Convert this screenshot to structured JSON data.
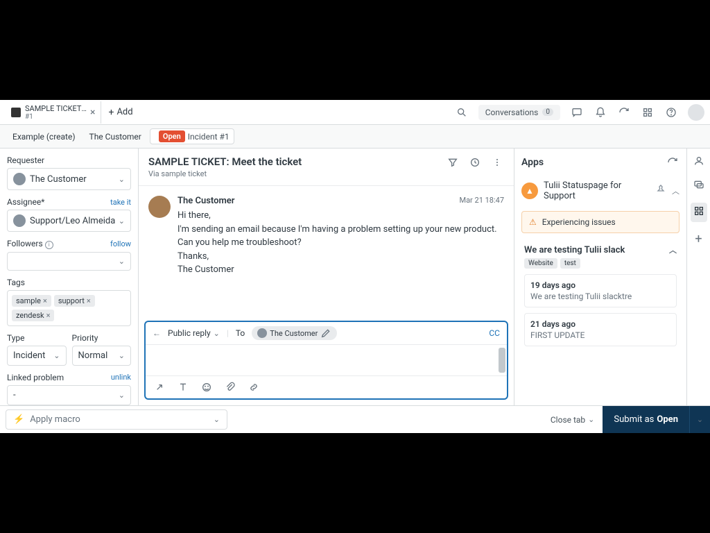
{
  "topbar": {
    "tab": {
      "title": "SAMPLE TICKET: Meet t...",
      "sub": "#1"
    },
    "add": "Add",
    "conversations": {
      "label": "Conversations",
      "count": "0"
    }
  },
  "breadcrumb": {
    "c1": "Example (create)",
    "c2": "The Customer",
    "status": "Open",
    "incident": "Incident #1"
  },
  "left": {
    "requester_label": "Requester",
    "requester_value": "The Customer",
    "assignee_label": "Assignee*",
    "assignee_link": "take it",
    "assignee_value": "Support/Leo Almeida",
    "followers_label": "Followers",
    "followers_link": "follow",
    "tags_label": "Tags",
    "tags": [
      "sample",
      "support",
      "zendesk"
    ],
    "type_label": "Type",
    "type_value": "Incident",
    "priority_label": "Priority",
    "priority_value": "Normal",
    "linked_label": "Linked problem",
    "linked_link": "unlink",
    "linked_value": "-"
  },
  "ticket": {
    "title": "SAMPLE TICKET: Meet the ticket",
    "via": "Via sample ticket",
    "author": "The Customer",
    "time": "Mar 21 18:47",
    "body_l1": "Hi there,",
    "body_l2": "I'm sending an email because I'm having a problem setting up your new product. Can you help me troubleshoot?",
    "body_l3": "Thanks,",
    "body_l4": "The Customer"
  },
  "reply": {
    "type": "Public reply",
    "to_label": "To",
    "to_value": "The Customer",
    "cc": "CC"
  },
  "apps": {
    "title": "Apps",
    "app_name": "Tulii Statuspage for Support",
    "alert": "Experiencing issues",
    "incident_title": "We are testing Tulii slack",
    "incident_tags": [
      "Website",
      "test"
    ],
    "updates": [
      {
        "when": "19 days ago",
        "desc": "We are testing Tulii slacktre"
      },
      {
        "when": "21 days ago",
        "desc": "FIRST UPDATE"
      }
    ]
  },
  "footer": {
    "macro": "Apply macro",
    "close": "Close tab",
    "submit_pre": "Submit as",
    "submit_status": "Open"
  }
}
